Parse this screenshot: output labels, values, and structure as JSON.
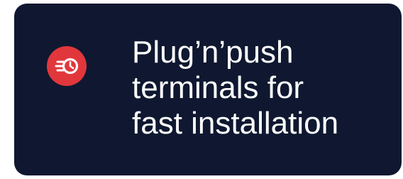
{
  "feature": {
    "lines": [
      "Plug’n’push",
      "terminals for",
      "fast installation"
    ],
    "icon": "fast-clock-icon",
    "colors": {
      "card_background": "#0f1830",
      "badge": "#e1373c",
      "text": "#ffffff"
    }
  }
}
